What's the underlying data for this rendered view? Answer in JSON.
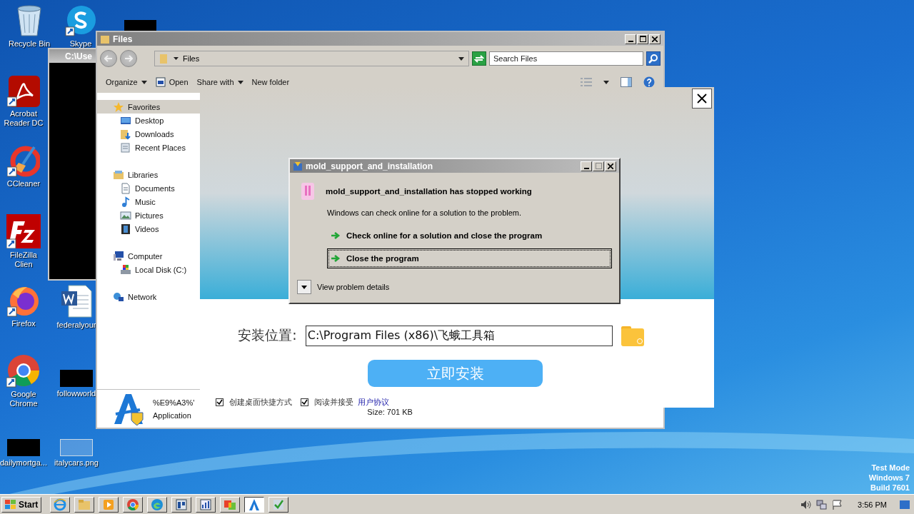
{
  "desktop_icons": [
    {
      "kind": "recycle",
      "label": "Recycle Bin"
    },
    {
      "kind": "skype",
      "label": "Skype"
    },
    {
      "kind": "thumbnail"
    },
    {
      "kind": "acrobat",
      "label": "Acrobat Reader DC"
    },
    {
      "kind": "ccleaner",
      "label": "CCleaner"
    },
    {
      "kind": "filezilla",
      "label": "FileZilla Clien"
    },
    {
      "kind": "firefox",
      "label": "Firefox"
    },
    {
      "kind": "word",
      "label": "federalyour"
    },
    {
      "kind": "chrome",
      "label": "Google Chrome"
    },
    {
      "kind": "thumbnail",
      "label": "followworld"
    },
    {
      "kind": "thumbnail",
      "label": "dailymortga..."
    },
    {
      "kind": "blank",
      "label": "italycars.png"
    }
  ],
  "console_window": {
    "title": "C:\\Use"
  },
  "explorer": {
    "title": "Files",
    "address": "Files",
    "search": {
      "placeholder": "Search Files"
    },
    "toolbar": [
      {
        "label": "Organize",
        "kind": "menu"
      },
      {
        "label": "Open",
        "kind": "open"
      },
      {
        "label": "Share with",
        "kind": "menu"
      },
      {
        "label": "New folder",
        "kind": "plain"
      }
    ],
    "nav": [
      {
        "label": "Favorites",
        "kind": "star",
        "selected": true,
        "children": [
          {
            "label": "Desktop",
            "kind": "desktop",
            "selected": false
          },
          {
            "label": "Downloads",
            "kind": "downloads",
            "selected": false
          },
          {
            "label": "Recent Places",
            "kind": "recent",
            "selected": false
          }
        ]
      },
      {
        "label": "Libraries",
        "kind": "libraries",
        "selected": false,
        "children": [
          {
            "label": "Documents",
            "kind": "documents",
            "selected": false
          },
          {
            "label": "Music",
            "kind": "music",
            "selected": false
          },
          {
            "label": "Pictures",
            "kind": "pictures",
            "selected": false
          },
          {
            "label": "Videos",
            "kind": "videos",
            "selected": false
          }
        ]
      },
      {
        "label": "Computer",
        "kind": "computer",
        "selected": false,
        "children": [
          {
            "label": "Local Disk (C:)",
            "kind": "disk",
            "selected": false
          }
        ]
      },
      {
        "label": "Network",
        "kind": "network",
        "selected": false
      }
    ],
    "details": {
      "name": "%E9%A3%'",
      "type": "Application",
      "size": "Size: 701 KB"
    }
  },
  "installer": {
    "location_label": "安装位置:",
    "location_value": "C:\\Program Files (x86)\\飞蛾工具箱",
    "install_button": "立即安装",
    "options": [
      {
        "label": "创建桌面快捷方式",
        "checked": true
      },
      {
        "label": "阅读并接受",
        "checked": true
      }
    ],
    "agreement_link": "用户协议"
  },
  "error_dialog": {
    "title": "mold_support_and_installation",
    "heading": "mold_support_and_installation has stopped working",
    "message": "Windows can check online for a solution to the problem.",
    "actions": [
      {
        "label": "Check online for a solution and close the program",
        "selected": false
      },
      {
        "label": "Close the program",
        "selected": true
      }
    ],
    "details_toggle": "View problem details"
  },
  "os_notice": [
    "Test Mode",
    "Windows 7",
    "Build 7601"
  ],
  "taskbar": {
    "start": "Start",
    "apps": [
      {
        "kind": "ie",
        "active": false
      },
      {
        "kind": "folder",
        "active": false
      },
      {
        "kind": "media",
        "active": false
      },
      {
        "kind": "chrome",
        "active": false
      },
      {
        "kind": "edge",
        "active": false
      },
      {
        "kind": "window",
        "active": false
      },
      {
        "kind": "chart",
        "active": false
      },
      {
        "kind": "blocks",
        "active": false
      },
      {
        "kind": "a-logo",
        "active": true
      },
      {
        "kind": "check",
        "active": false
      }
    ],
    "time": "3:56 PM"
  }
}
